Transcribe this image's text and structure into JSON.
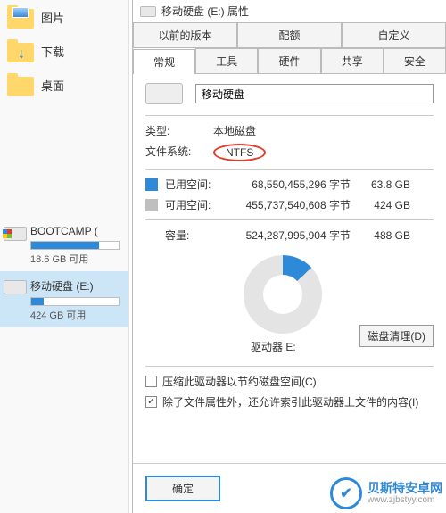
{
  "explorer": {
    "folders": [
      {
        "label": "图片",
        "icon": "pic"
      },
      {
        "label": "下载",
        "icon": "down"
      },
      {
        "label": "桌面",
        "icon": "plain"
      }
    ],
    "drives": [
      {
        "name": "BOOTCAMP (",
        "sub": "18.6 GB 可用",
        "fill_pct": 78,
        "win": true,
        "selected": false
      },
      {
        "name": "移动硬盘 (E:)",
        "sub": "424 GB 可用",
        "fill_pct": 14,
        "win": false,
        "selected": true
      }
    ]
  },
  "dialog": {
    "title_prefix": "移动硬盘 (E:) 属性",
    "tabs_row1": [
      "以前的版本",
      "配额",
      "自定义"
    ],
    "tabs_row2": [
      "常规",
      "工具",
      "硬件",
      "共享",
      "安全"
    ],
    "name_value": "移动硬盘",
    "type_label": "类型:",
    "type_value": "本地磁盘",
    "fs_label": "文件系统:",
    "fs_value": "NTFS",
    "used_label": "已用空间:",
    "used_bytes": "68,550,455,296 字节",
    "used_gb": "63.8 GB",
    "free_label": "可用空间:",
    "free_bytes": "455,737,540,608 字节",
    "free_gb": "424 GB",
    "cap_label": "容量:",
    "cap_bytes": "524,287,995,904 字节",
    "cap_gb": "488 GB",
    "drive_label": "驱动器 E:",
    "cleanup_btn": "磁盘清理(D)",
    "chk_compress": "压缩此驱动器以节约磁盘空间(C)",
    "chk_index": "除了文件属性外，还允许索引此驱动器上文件的内容(I)",
    "chk_index_checked": true,
    "ok_label": "确定"
  },
  "watermark": {
    "name": "贝斯特安卓网",
    "url": "www.zjbstyy.com"
  }
}
